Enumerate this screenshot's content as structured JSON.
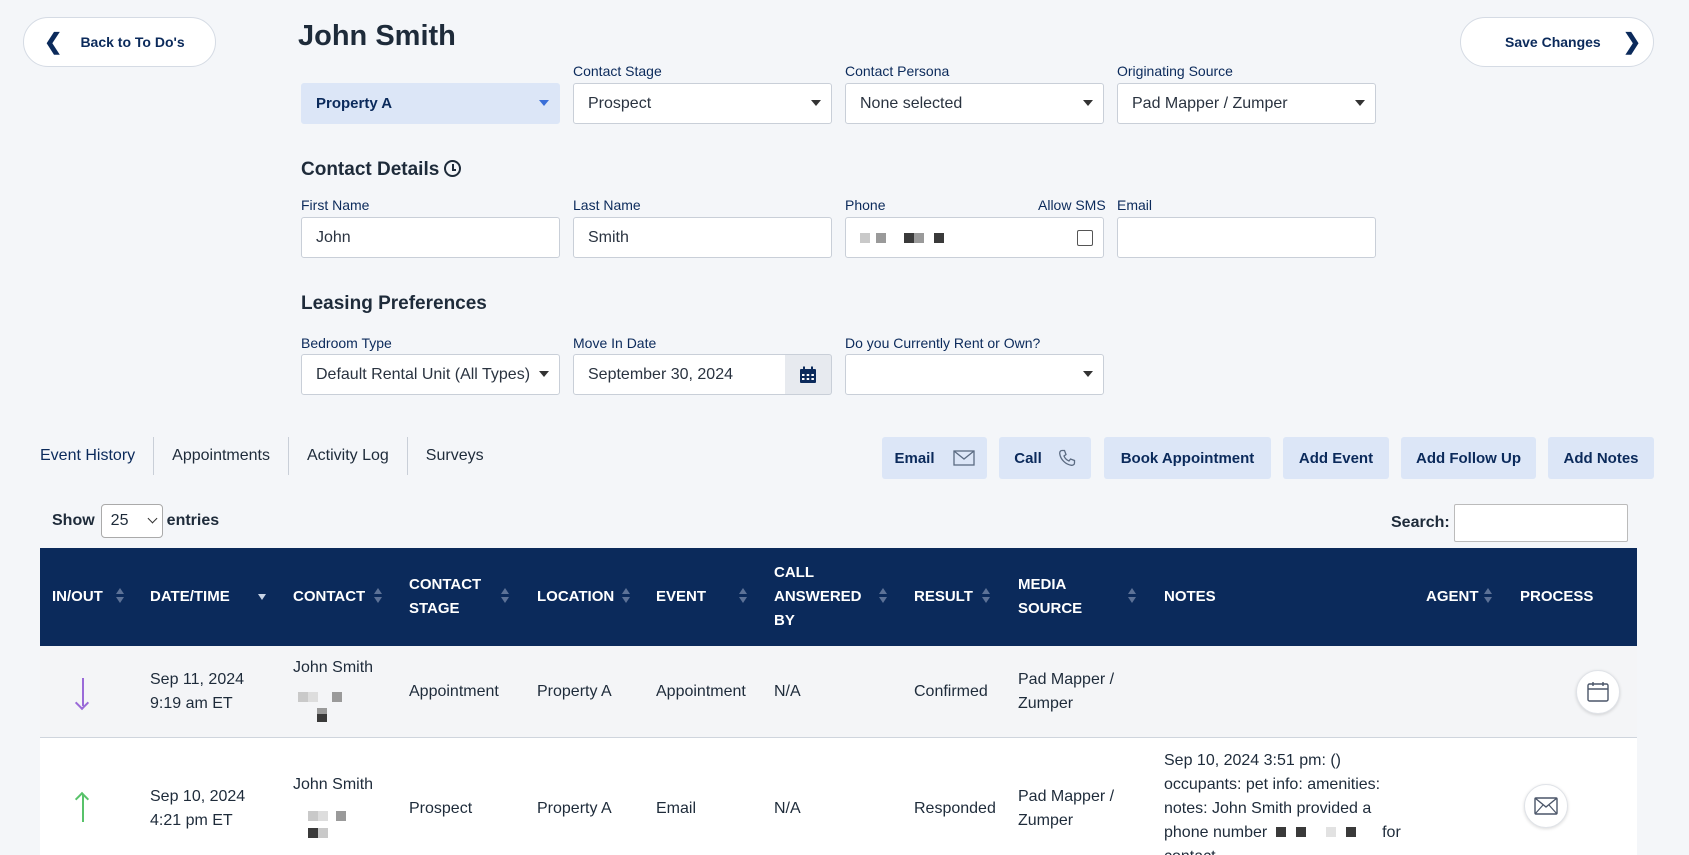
{
  "header": {
    "back_label": "Back to To Do's",
    "contact_name": "John Smith",
    "save_label": "Save Changes"
  },
  "selectors": {
    "property": {
      "value": "Property A"
    },
    "contact_stage": {
      "label": "Contact Stage",
      "value": "Prospect"
    },
    "contact_persona": {
      "label": "Contact Persona",
      "value": "None selected"
    },
    "originating_source": {
      "label": "Originating Source",
      "value": "Pad Mapper / Zumper"
    }
  },
  "contact_details": {
    "title": "Contact Details",
    "first_name": {
      "label": "First Name",
      "value": "John"
    },
    "last_name": {
      "label": "Last Name",
      "value": "Smith"
    },
    "phone": {
      "label": "Phone"
    },
    "allow_sms": {
      "label": "Allow SMS",
      "checked": false
    },
    "email": {
      "label": "Email",
      "value": ""
    }
  },
  "leasing_preferences": {
    "title": "Leasing Preferences",
    "bedroom_type": {
      "label": "Bedroom Type",
      "value": "Default Rental Unit (All Types)"
    },
    "move_in_date": {
      "label": "Move In Date",
      "value": "September 30, 2024"
    },
    "rent_or_own": {
      "label": "Do you Currently Rent or Own?",
      "value": ""
    }
  },
  "tabs": [
    {
      "label": "Event History",
      "active": true
    },
    {
      "label": "Appointments"
    },
    {
      "label": "Activity Log"
    },
    {
      "label": "Surveys"
    }
  ],
  "actions": {
    "email": "Email",
    "call": "Call",
    "book_appointment": "Book Appointment",
    "add_event": "Add Event",
    "add_follow_up": "Add Follow Up",
    "add_notes": "Add Notes"
  },
  "table_controls": {
    "show": "Show",
    "entries_count": "25",
    "entries": "entries",
    "search_label": "Search:"
  },
  "table": {
    "columns": [
      "IN/OUT",
      "DATE/TIME",
      "CONTACT",
      "CONTACT STAGE",
      "LOCATION",
      "EVENT",
      "CALL ANSWERED BY",
      "RESULT",
      "MEDIA SOURCE",
      "NOTES",
      "AGENT",
      "PROCESS"
    ],
    "rows": [
      {
        "direction": "in",
        "date": "Sep 11, 2024",
        "time": "9:19 am ET",
        "contact": "John Smith",
        "stage": "Appointment",
        "location": "Property A",
        "event": "Appointment",
        "answered_by": "N/A",
        "result": "Confirmed",
        "media_source": "Pad Mapper / Zumper",
        "notes": "",
        "agent": "",
        "process_icon": "calendar-icon"
      },
      {
        "direction": "out",
        "date": "Sep 10, 2024",
        "time": "4:21 pm ET",
        "contact": "John Smith",
        "stage": "Prospect",
        "location": "Property A",
        "event": "Email",
        "answered_by": "N/A",
        "result": "Responded",
        "media_source": "Pad Mapper / Zumper",
        "notes_line1": "Sep 10, 2024 3:51 pm: ()",
        "notes_line2": "occupants: pet info: amenities:",
        "notes_line3": "notes: John Smith provided a",
        "notes_line4a": "phone number",
        "notes_line4b": "for",
        "notes_line5": "contact.",
        "agent": "",
        "process_icon": "envelope-icon"
      }
    ]
  }
}
